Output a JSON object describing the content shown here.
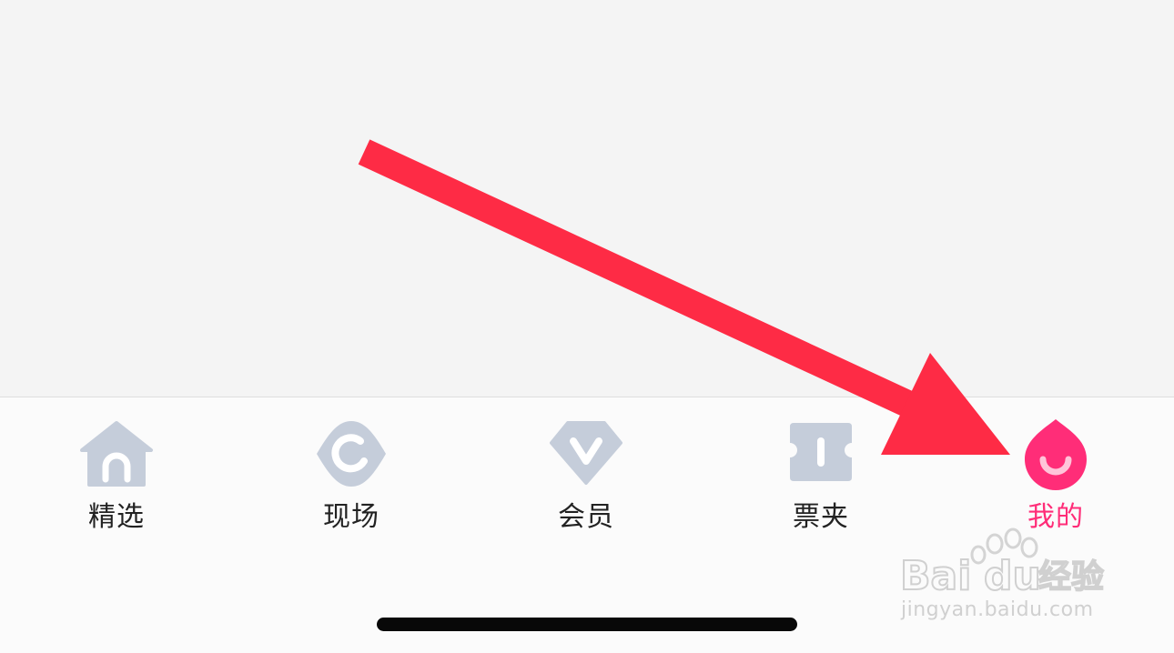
{
  "tabbar": {
    "tabs": [
      {
        "label": "精选",
        "icon": "home-icon",
        "active": false
      },
      {
        "label": "现场",
        "icon": "live-icon",
        "active": false
      },
      {
        "label": "会员",
        "icon": "vip-icon",
        "active": false
      },
      {
        "label": "票夹",
        "icon": "ticket-icon",
        "active": false
      },
      {
        "label": "我的",
        "icon": "profile-icon",
        "active": true
      }
    ],
    "colors": {
      "inactive_icon": "#c5cdda",
      "active": "#ff2d78",
      "label": "#222222"
    }
  },
  "annotation": {
    "arrow_color": "#fe2b45"
  },
  "watermark": {
    "brand": "Baidu经验",
    "url": "jingyan.baidu.com"
  }
}
